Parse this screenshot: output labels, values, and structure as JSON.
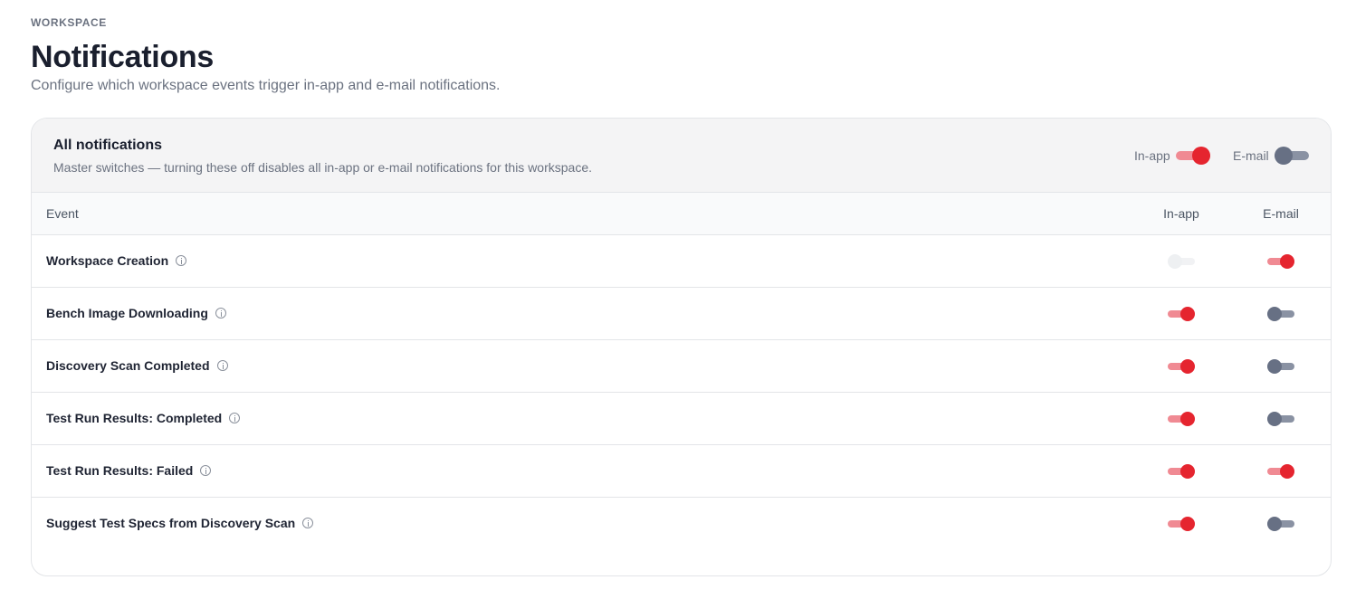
{
  "header": {
    "eyebrow": "WORKSPACE",
    "title": "Notifications",
    "subtitle": "Configure which workspace events trigger in-app and e-mail notifications."
  },
  "master": {
    "title": "All notifications",
    "description": "Master switches — turning these off disables all in-app or e-mail notifications for this workspace.",
    "inapp_label": "In-app",
    "inapp_on": true,
    "email_label": "E-mail",
    "email_on": false
  },
  "table": {
    "col_event": "Event",
    "col_inapp": "In-app",
    "col_email": "E-mail",
    "rows": [
      {
        "name": "Workspace Creation",
        "inapp": "disabled",
        "email": "on"
      },
      {
        "name": "Bench Image Downloading",
        "inapp": "on",
        "email": "off"
      },
      {
        "name": "Discovery Scan Completed",
        "inapp": "on",
        "email": "off"
      },
      {
        "name": "Test Run Results: Completed",
        "inapp": "on",
        "email": "off"
      },
      {
        "name": "Test Run Results: Failed",
        "inapp": "on",
        "email": "on"
      },
      {
        "name": "Suggest Test Specs from Discovery Scan",
        "inapp": "on",
        "email": "off"
      }
    ]
  },
  "colors": {
    "accent": "#e5252f",
    "accent_track": "#f08a93",
    "off_knob": "#677084",
    "off_track": "#8a92a3"
  },
  "icons": {
    "info": "info-circle-icon"
  }
}
